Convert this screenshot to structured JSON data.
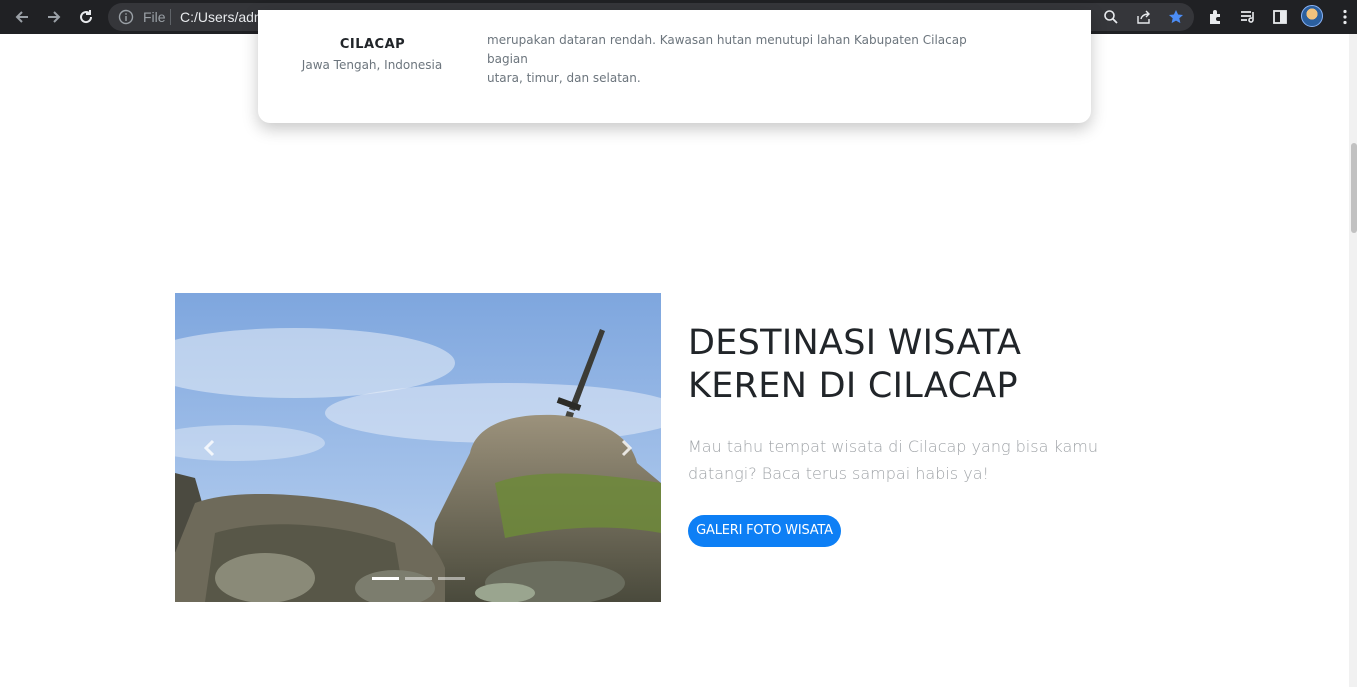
{
  "browser": {
    "file_label": "File",
    "url": "C:/Users/admin/Documents/weblanding/index.html",
    "icons": [
      "back-icon",
      "forward-icon",
      "reload-icon",
      "info-icon",
      "zoom-icon",
      "share-icon",
      "star-icon",
      "extensions-icon",
      "reading-list-icon",
      "side-panel-icon",
      "profile-avatar",
      "menu-icon"
    ],
    "accent_color": "#8ab4f8",
    "star_color": "#4c8df6"
  },
  "card": {
    "city": "CILACAP",
    "region": "Jawa Tengah, Indonesia",
    "description_line1": "merupakan dataran rendah. Kawasan hutan menutupi lahan Kabupaten Cilacap bagian",
    "description_line2": "utara, timur, dan selatan."
  },
  "hero": {
    "title_line1": "DESTINASI WISATA",
    "title_line2": "KEREN DI CILACAP",
    "subtitle": "Mau tahu tempat wisata di Cilacap yang bisa kamu datangi? Baca terus sampai habis ya!",
    "button_label": "GALERI FOTO WISATA",
    "button_color": "#0d7ff5"
  },
  "carousel": {
    "slide_count": 3,
    "active_slide": 1
  }
}
